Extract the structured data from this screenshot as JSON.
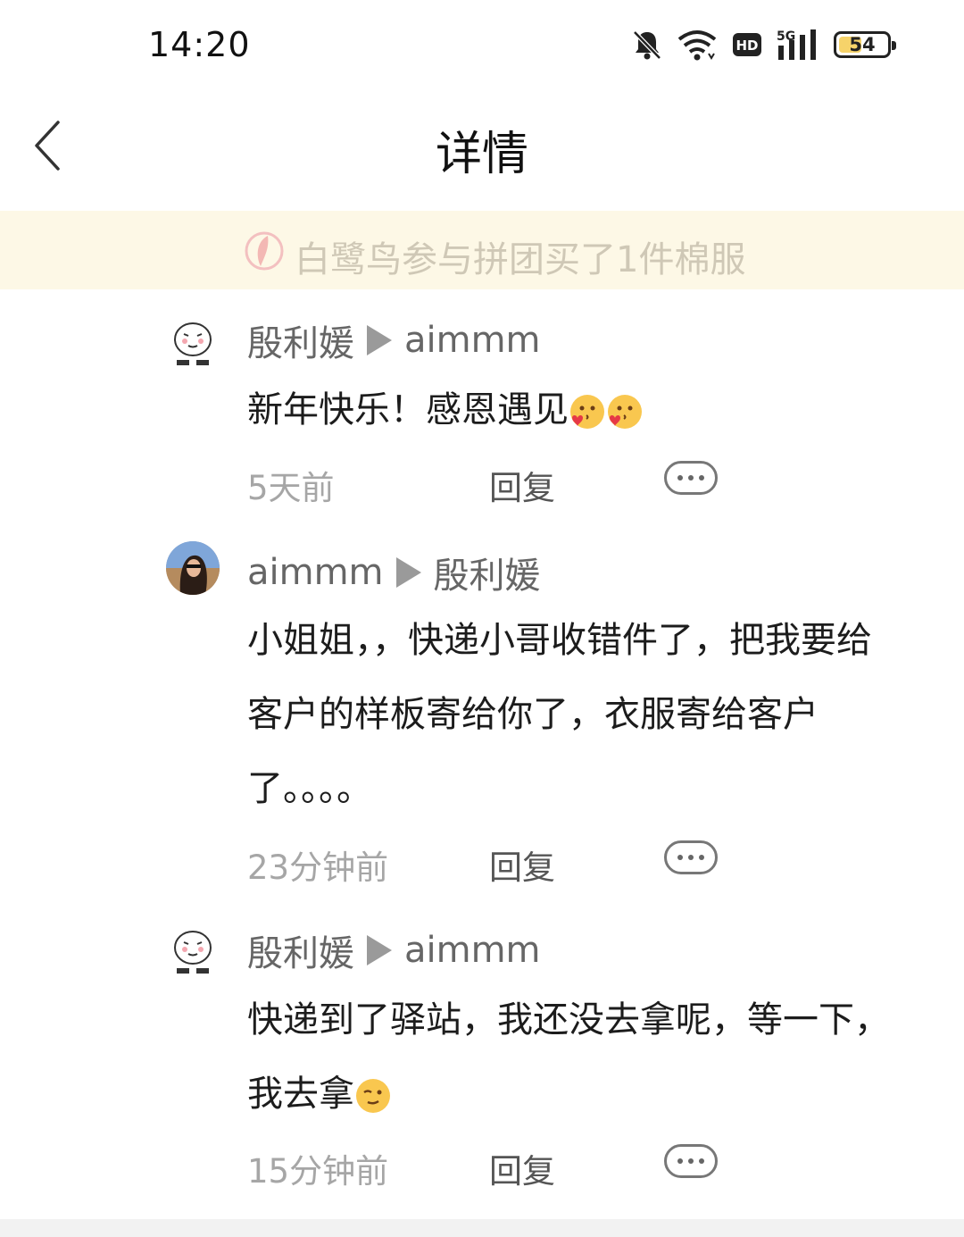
{
  "status_bar": {
    "time": "14:20",
    "icons": [
      "bell-off-icon",
      "wifi-icon",
      "hd-icon",
      "5g-signal-icon"
    ],
    "network_label": "5G",
    "hd_label": "HD",
    "battery": "54"
  },
  "header": {
    "title": "详情",
    "back_icon": "chevron-left-icon"
  },
  "notice": {
    "icon": "feather-icon",
    "text": "白鹭鸟参与拼团买了1件棉服"
  },
  "comments": [
    {
      "author": "殷利媛",
      "reply_to": "aimmm",
      "text": "新年快乐！感恩遇见",
      "time": "5天前",
      "reply_label": "回复"
    },
    {
      "author": "aimmm",
      "reply_to": "殷利媛",
      "text": "小姐姐，，快递小哥收错件了，把我要给客户的样板寄给你了，衣服寄给客户了。。。。",
      "time": "23分钟前",
      "reply_label": "回复"
    },
    {
      "author": "殷利媛",
      "reply_to": "aimmm",
      "text": "快递到了驿站，我还没去拿呢，等一下，我去拿",
      "time": "15分钟前",
      "reply_label": "回复"
    }
  ],
  "colors": {
    "notice_bg": "#fdf8e6",
    "meta_gray": "#a6a6a6",
    "text_dark": "#1c1c1c"
  }
}
